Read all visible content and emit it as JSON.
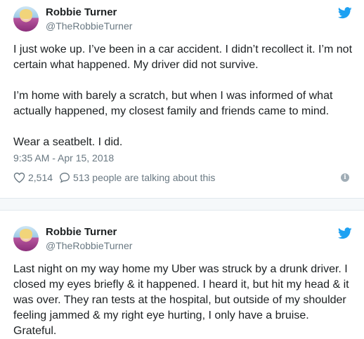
{
  "tweets": [
    {
      "name": "Robbie Turner",
      "handle": "@TheRobbieTurner",
      "paragraphs": [
        "I just woke up. I’ve been in a car accident. I didn’t recollect it. I’m not certain what happened. My driver did not survive.",
        "I’m home with barely a scratch, but when I was informed of what actually happened, my closest family and friends came to mind.",
        "Wear a seatbelt. I did."
      ],
      "timestamp": "9:35 AM - Apr 15, 2018",
      "likes": "2,514",
      "talking": "513 people are talking about this"
    },
    {
      "name": "Robbie Turner",
      "handle": "@TheRobbieTurner",
      "paragraphs": [
        "Last night on my way home my Uber was struck by a drunk driver. I closed my eyes briefly & it happened. I heard it, but hit my head & it was over. They ran tests at the hospital, but outside of my shoulder feeling jammed & my right eye hurting, I only have a bruise. Grateful."
      ]
    }
  ],
  "icons": {
    "brand": "twitter-bird-icon",
    "like": "heart-icon",
    "reply": "speech-bubble-icon",
    "info": "info-icon"
  },
  "colors": {
    "twitter_blue": "#1da1f2",
    "text": "#1c2022",
    "secondary_text": "#697882",
    "divider": "#e1e8ed"
  }
}
